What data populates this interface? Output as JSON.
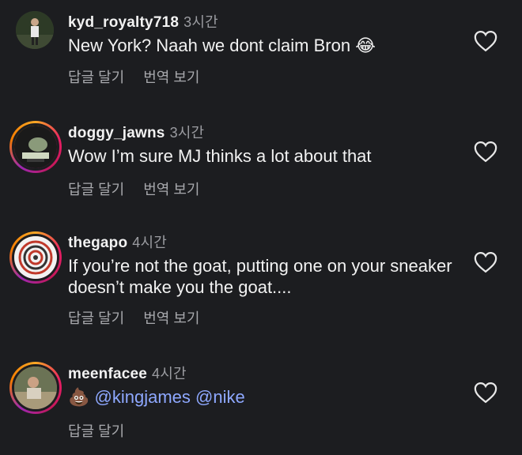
{
  "comments": [
    {
      "username": "kyd_royalty718",
      "time": "3시간",
      "text": "New York? Naah we dont claim Bron",
      "emoji": "😂",
      "reply_label": "답글 달기",
      "translate_label": "번역 보기"
    },
    {
      "username": "doggy_jawns",
      "time": "3시간",
      "text": "Wow I’m sure MJ thinks a lot about that",
      "reply_label": "답글 달기",
      "translate_label": "번역 보기"
    },
    {
      "username": "thegapo",
      "time": "4시간",
      "text": "If you’re not the goat, putting one on your sneaker doesn’t make you the goat....",
      "reply_label": "답글 달기",
      "translate_label": "번역 보기"
    },
    {
      "username": "meenfacee",
      "time": "4시간",
      "emoji": "💩",
      "mention_1": "@kingjames",
      "mention_2": "@nike",
      "reply_label": "답글 달기"
    }
  ],
  "icons": {
    "like": "heart-outline-icon"
  },
  "colors": {
    "background": "#1c1d20",
    "mention": "#8ea8ff",
    "secondary_text": "#a8a9ad"
  }
}
